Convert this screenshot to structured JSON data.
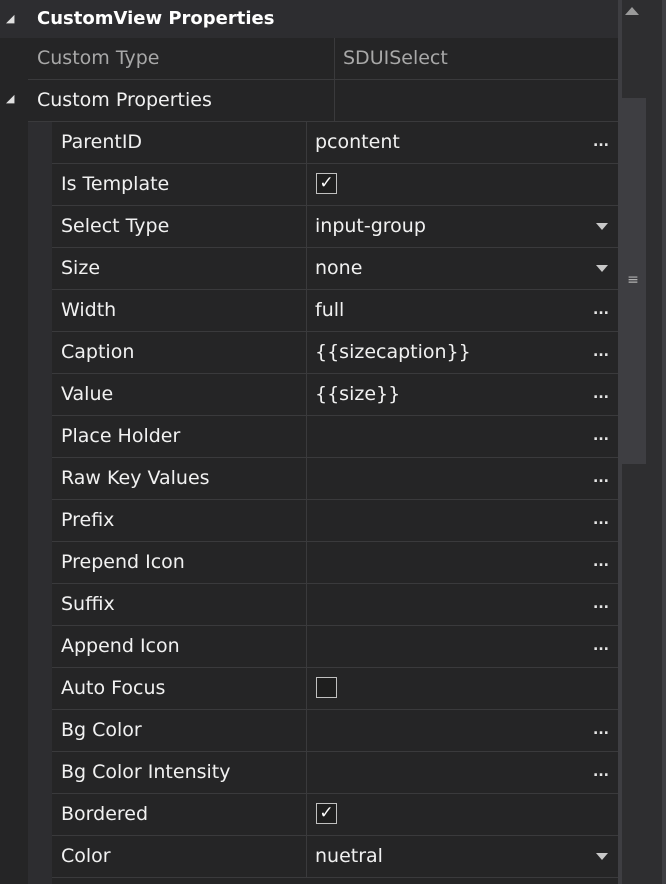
{
  "header": {
    "title": "CustomView Properties",
    "toggle_glyph": "◢"
  },
  "custom_type": {
    "label": "Custom Type",
    "value": "SDUISelect"
  },
  "custom_properties": {
    "label": "Custom Properties",
    "toggle_glyph": "◢",
    "rows": [
      {
        "label": "ParentID",
        "value": "pcontent",
        "editor": "ellipsis"
      },
      {
        "label": "Is Template",
        "value": "",
        "editor": "checkbox",
        "checked": true
      },
      {
        "label": "Select Type",
        "value": "input-group",
        "editor": "dropdown"
      },
      {
        "label": "Size",
        "value": "none",
        "editor": "dropdown"
      },
      {
        "label": "Width",
        "value": "full",
        "editor": "ellipsis"
      },
      {
        "label": "Caption",
        "value": "{{sizecaption}}",
        "editor": "ellipsis"
      },
      {
        "label": "Value",
        "value": "{{size}}",
        "editor": "ellipsis"
      },
      {
        "label": "Place Holder",
        "value": "",
        "editor": "ellipsis"
      },
      {
        "label": "Raw Key Values",
        "value": "",
        "editor": "ellipsis"
      },
      {
        "label": "Prefix",
        "value": "",
        "editor": "ellipsis"
      },
      {
        "label": "Prepend Icon",
        "value": "",
        "editor": "ellipsis"
      },
      {
        "label": "Suffix",
        "value": "",
        "editor": "ellipsis"
      },
      {
        "label": "Append Icon",
        "value": "",
        "editor": "ellipsis"
      },
      {
        "label": "Auto Focus",
        "value": "",
        "editor": "checkbox",
        "checked": false
      },
      {
        "label": "Bg Color",
        "value": "",
        "editor": "ellipsis"
      },
      {
        "label": "Bg Color Intensity",
        "value": "",
        "editor": "ellipsis"
      },
      {
        "label": "Bordered",
        "value": "",
        "editor": "checkbox",
        "checked": true
      },
      {
        "label": "Color",
        "value": "nuetral",
        "editor": "dropdown"
      }
    ]
  },
  "glyphs": {
    "ellipsis": "...",
    "check": "✓",
    "grip": "≡"
  },
  "colors": {
    "background": "#252526",
    "header_bg": "#2d2d30",
    "text": "#f1f1f1",
    "inactive_text": "#a8a8a8",
    "grid_line": "#3a3a3c"
  }
}
